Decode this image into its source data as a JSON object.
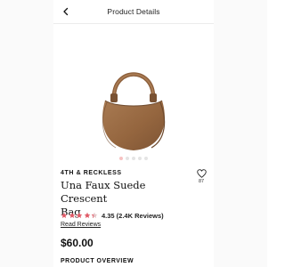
{
  "header": {
    "title": "Product Details",
    "back_icon": "chevron-left-icon"
  },
  "product": {
    "brand": "4TH & RECKLESS",
    "name_line1": "Una Faux Suede Crescent",
    "name_line2": "Bag",
    "rating_value": 4.35,
    "rating_text": "4.35 (2.4K Reviews)",
    "reviews_link": "Read Reviews",
    "price": "$60.00",
    "wishlist_count": "87",
    "wishlist_icon": "heart-outline-icon"
  },
  "carousel": {
    "total": 5,
    "active_index": 0
  },
  "sections": {
    "overview_heading": "PRODUCT OVERVIEW"
  },
  "colors": {
    "star_fill": "#e05a67",
    "star_empty": "#e3c3c6",
    "bag_main": "#9b6b45",
    "bag_dark": "#7a5233",
    "dot_active": "#f7c2c2"
  }
}
